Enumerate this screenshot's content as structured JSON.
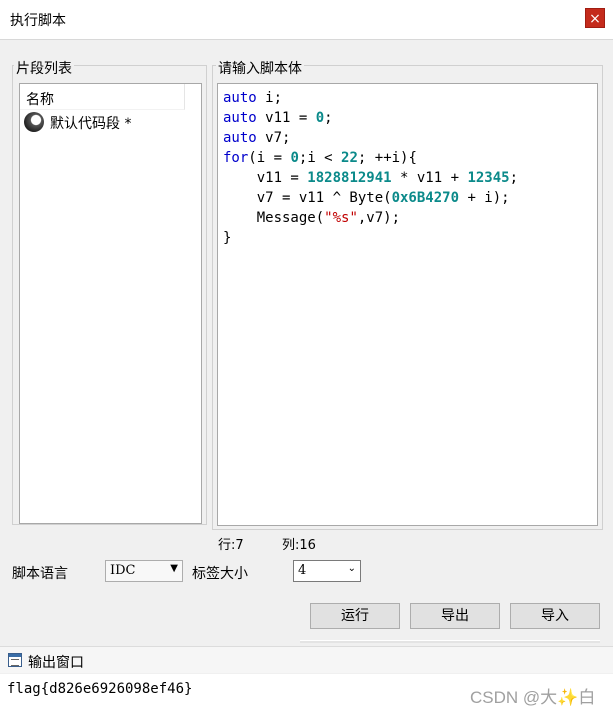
{
  "window": {
    "title": "执行脚本",
    "close_label": "×"
  },
  "snippets": {
    "group_label": "片段列表",
    "column_header": "名称",
    "items": [
      {
        "label": "默认代码段 *"
      }
    ]
  },
  "editor": {
    "group_label": "请输入脚本体",
    "status_row": "行:7",
    "status_col": "列:16"
  },
  "settings": {
    "language_label": "脚本语言",
    "language_value": "IDC",
    "tab_size_label": "标签大小",
    "tab_size_value": "4"
  },
  "buttons": {
    "run": "运行",
    "export": "导出",
    "import": "导入"
  },
  "output": {
    "title": "输出窗口",
    "text": "flag{d826e6926098ef46}"
  },
  "watermark": "CSDN @大✨白",
  "colors": {
    "keyword": "#0000cc",
    "number": "#0b8a8a",
    "string": "#c00000",
    "close": "#c42b1c"
  }
}
